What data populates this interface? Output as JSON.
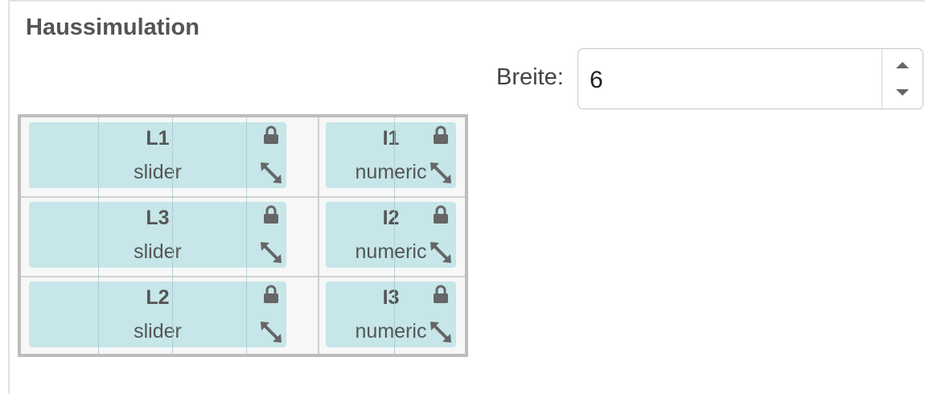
{
  "panel": {
    "title": "Haussimulation"
  },
  "width_control": {
    "label": "Breite:",
    "value": "6"
  },
  "tiles": [
    {
      "name": "L1",
      "type": "slider"
    },
    {
      "name": "I1",
      "type": "numeric"
    },
    {
      "name": "L3",
      "type": "slider"
    },
    {
      "name": "I2",
      "type": "numeric"
    },
    {
      "name": "L2",
      "type": "slider"
    },
    {
      "name": "I3",
      "type": "numeric"
    }
  ],
  "colors": {
    "tile_fill": "#c6e6e9",
    "grid_border": "#bdbdbd",
    "icon": "#666666"
  },
  "icons": {
    "lock": "lock-icon",
    "resize": "resize-icon"
  }
}
